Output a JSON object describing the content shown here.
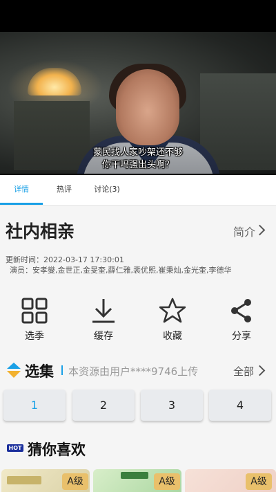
{
  "video": {
    "subtitle_line1": "蒙民找人家吵架还不够",
    "subtitle_line2": "你干吗强出头啊？"
  },
  "tabs": [
    {
      "label": "详情",
      "active": true
    },
    {
      "label": "热评",
      "active": false
    },
    {
      "label": "讨论(3)",
      "active": false
    }
  ],
  "info": {
    "title": "社内相亲",
    "intro_label": "简介",
    "update_time": "更新时间：2022-03-17 17:30:01",
    "cast": "演员：安孝燮,金世正,金旻奎,薛仁雅,裴优熙,崔秉灿,金光奎,李德华"
  },
  "actions": [
    {
      "label": "选季",
      "icon": "grid-icon"
    },
    {
      "label": "缓存",
      "icon": "download-icon"
    },
    {
      "label": "收藏",
      "icon": "star-icon"
    },
    {
      "label": "分享",
      "icon": "share-icon"
    }
  ],
  "episodes": {
    "title": "选集",
    "uploader": "本资源由用户****9746上传",
    "all_label": "全部",
    "items": [
      "1",
      "2",
      "3",
      "4"
    ],
    "active_index": 0
  },
  "recommend": {
    "hot_badge": "HOT",
    "title": "猜你喜欢",
    "items": [
      {
        "grade": "A级"
      },
      {
        "grade": "A级"
      },
      {
        "grade": "A级"
      }
    ]
  },
  "colors": {
    "accent": "#1aa0e6",
    "grade_badge": "#e9c06b",
    "hot_badge": "#1b2f9c"
  }
}
